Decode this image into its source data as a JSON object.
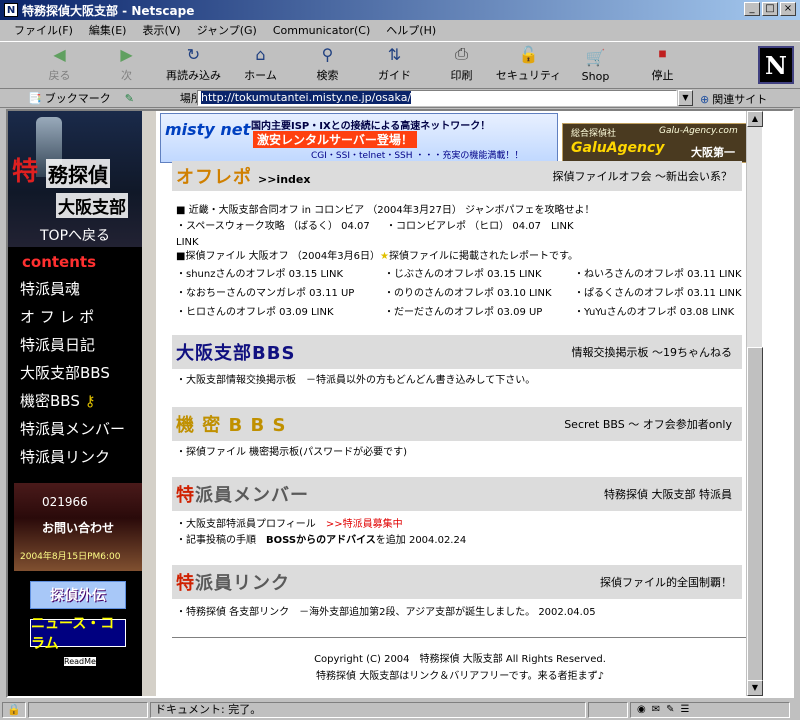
{
  "window": {
    "title": "特務探偵大阪支部 - Netscape",
    "buttons": [
      "_",
      "□",
      "×"
    ]
  },
  "menubar": [
    "ファイル(F)",
    "編集(E)",
    "表示(V)",
    "ジャンプ(G)",
    "Communicator(C)",
    "ヘルプ(H)"
  ],
  "toolbar": [
    {
      "label": "戻る",
      "icon": "back-arrow-icon",
      "disabled": true
    },
    {
      "label": "次",
      "icon": "forward-arrow-icon",
      "disabled": true
    },
    {
      "label": "再読み込み",
      "icon": "reload-icon",
      "disabled": false
    },
    {
      "label": "ホーム",
      "icon": "home-icon",
      "disabled": false
    },
    {
      "label": "検索",
      "icon": "search-icon",
      "disabled": false
    },
    {
      "label": "ガイド",
      "icon": "guide-icon",
      "disabled": false
    },
    {
      "label": "印刷",
      "icon": "print-icon",
      "disabled": false
    },
    {
      "label": "セキュリティ",
      "icon": "security-lock-icon",
      "disabled": false
    },
    {
      "label": "Shop",
      "icon": "shop-icon",
      "disabled": false
    },
    {
      "label": "停止",
      "icon": "stop-icon",
      "disabled": false
    }
  ],
  "locbar": {
    "bookmark": "ブックマーク",
    "label": "場所:",
    "url": "http://tokumutantei.misty.ne.jp/osaka/",
    "related": "関連サイト"
  },
  "sidebar": {
    "brand_red": "特",
    "brand_rest": "務探偵",
    "brand_sub": "大阪支部",
    "top_link": "TOPへ戻る",
    "contents": "contents",
    "nav": [
      "特派員魂",
      "オ フ レ ポ",
      "特派員日記",
      "大阪支部BBS",
      "機密BBS",
      "特派員メンバー",
      "特派員リンク"
    ],
    "contact_phone": "021966",
    "contact_label": "お問い合わせ",
    "contact_sub": "2004年8月15日PM6:00",
    "banner1": "探偵外伝",
    "banner2": "ニュース・コラム",
    "readme": "ReadMe!"
  },
  "banners": {
    "misty_logo": "misty net",
    "misty_l1": "国内主要ISP・IXとの接続による高速ネットワーク！",
    "misty_l2": "激安レンタルサーバー登場！",
    "misty_l3": "CGI・SSI・telnet・SSH ・・・充実の機能満載！！",
    "galu_l1": "総合探偵社",
    "galu_url": "Galu-Agency.com",
    "galu_name": "GaluAgency",
    "galu_branch": "大阪第一"
  },
  "sections": {
    "offrepo": {
      "first": "オ",
      "rest": "フレポ",
      "extra": ">>index",
      "desc": "探偵ファイルオフ会 〜新出会い系？"
    },
    "offrepo_items": {
      "l1": "■ 近畿・大阪支部合同オフ in コロンビア （2004年3月27日） ジャンボパフェを攻略せよ！",
      "l2a": "・スペースウォーク攻略 （ばるく） 04.07　LINK",
      "l2b": "・コロンビアレポ （ヒロ） 04.07　LINK",
      "l3": "■探偵ファイル 大阪オフ （2004年3月6日）",
      "l3b": "探偵ファイルに掲載されたレポートです。",
      "star": "★",
      "grid": [
        "・shunzさんのオフレポ 03.15 LINK",
        "・じぶさんのオフレポ 03.15 LINK",
        "・ねいろさんのオフレポ 03.11 LINK",
        "・なおちーさんのマンガレポ 03.11 UP",
        "・のりのさんのオフレポ 03.10 LINK",
        "・ぱるくさんのオフレポ 03.11 LINK",
        "・ヒロさんのオフレポ 03.09 LINK",
        "・だーださんのオフレポ 03.09 UP",
        "・YuYuさんのオフレポ 03.08 LINK"
      ]
    },
    "bbs": {
      "first": "大",
      "rest": "阪支部BBS",
      "desc": "情報交換掲示板 〜19ちゃんねる",
      "text": "・大阪支部情報交換掲示板　－特派員以外の方もどんどん書き込みして下さい。"
    },
    "secret": {
      "first": "機",
      "rest": " 密 B B S",
      "desc": "Secret BBS 〜 オフ会参加者only",
      "text": "・探偵ファイル 機密掲示板(パスワードが必要です)"
    },
    "members": {
      "first": "特",
      "rest": "派員メンバー",
      "desc": "特務探偵 大阪支部 特派員",
      "t1": "・大阪支部特派員プロフィール",
      "t1b": ">>特派員募集中",
      "t2a": "・記事投稿の手順",
      "t2b": "BOSSからのアドバイス",
      "t2c": "を追加 2004.02.24"
    },
    "links": {
      "first": "特",
      "rest": "派員リンク",
      "desc": "探偵ファイル的全国制覇！",
      "text": "・特務探偵 各支部リンク　－海外支部追加第2段、アジア支部が誕生しました。 2002.04.05"
    }
  },
  "footer": {
    "l1": "Copyright (C) 2004　特務探偵 大阪支部 All Rights Reserved.",
    "l2": "特務探偵 大阪支部はリンク＆バリアフリーです。来る者拒まず♪"
  },
  "status": {
    "text": "ドキュメント: 完了。"
  },
  "colors": {
    "title_bar": "#0a246a",
    "accent_red": "#d02000",
    "bbs_blue": "#101080",
    "secret_gold": "#c09000"
  }
}
